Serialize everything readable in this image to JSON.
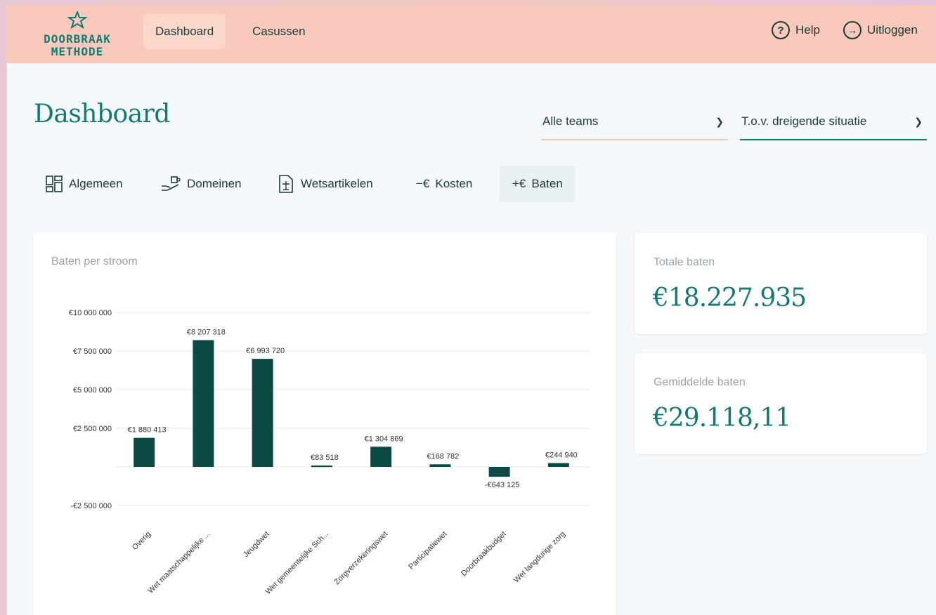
{
  "app": {
    "logo_line1": "DOORBRAAK",
    "logo_line2": "METHODE"
  },
  "nav": {
    "items": [
      {
        "label": "Dashboard",
        "active": true
      },
      {
        "label": "Casussen",
        "active": false
      }
    ],
    "help_label": "Help",
    "logout_label": "Uitloggen"
  },
  "page": {
    "title": "Dashboard"
  },
  "filters": {
    "team_select": "Alle teams",
    "situation_select": "T.o.v. dreigende situatie"
  },
  "tabs": [
    {
      "label": "Algemeen",
      "icon": "grid-icon"
    },
    {
      "label": "Domeinen",
      "icon": "hand-puzzle-icon"
    },
    {
      "label": "Wetsartikelen",
      "icon": "law-document-icon"
    },
    {
      "label": "Kosten",
      "prefix": "−€"
    },
    {
      "label": "Baten",
      "prefix": "+€",
      "active": true
    }
  ],
  "stats": {
    "total_label": "Totale baten",
    "total_value": "€18.227.935",
    "avg_label": "Gemiddelde baten",
    "avg_value": "€29.118,11"
  },
  "colors": {
    "accent": "#137a72",
    "bar": "#0b4a44",
    "topbar": "#f9cabb"
  },
  "chart_data": {
    "type": "bar",
    "title": "Baten per stroom",
    "categories": [
      "Overig",
      "Wet maatschappelijke ...",
      "Jeugdwet",
      "Wet gemeentelijke Sch...",
      "Zorgverzekeringswet",
      "Participatiewet",
      "Doorbraakbudget",
      "Wet langdurige zorg"
    ],
    "values": [
      1880413,
      8207318,
      6993720,
      83518,
      1304869,
      168782,
      -643125,
      244940
    ],
    "value_labels": [
      "€1 880 413",
      "€8 207 318",
      "€6 993 720",
      "€83 518",
      "€1 304 869",
      "€168 782",
      "-€643 125",
      "€244 940"
    ],
    "y_ticks": [
      -2500000,
      2500000,
      5000000,
      7500000,
      10000000
    ],
    "y_tick_labels": [
      "-€2 500 000",
      "€2 500 000",
      "€5 000 000",
      "€7 500 000",
      "€10 000 000"
    ],
    "ylim": [
      -2500000,
      10000000
    ],
    "grid": true
  }
}
